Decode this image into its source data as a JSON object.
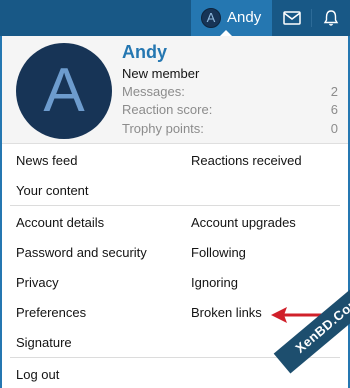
{
  "topbar": {
    "user_initial": "A",
    "user_name": "Andy",
    "icons": [
      "envelope-icon",
      "bell-icon"
    ]
  },
  "profile": {
    "avatar_initial": "A",
    "name": "Andy",
    "user_title": "New member",
    "stats": [
      {
        "label": "Messages:",
        "value": "2"
      },
      {
        "label": "Reaction score:",
        "value": "6"
      },
      {
        "label": "Trophy points:",
        "value": "0"
      }
    ]
  },
  "menu": {
    "news_feed": "News feed",
    "reactions_received": "Reactions received",
    "your_content": "Your content",
    "account_details": "Account details",
    "account_upgrades": "Account upgrades",
    "password_security": "Password and security",
    "following": "Following",
    "privacy": "Privacy",
    "ignoring": "Ignoring",
    "preferences": "Preferences",
    "broken_links": "Broken links",
    "signature": "Signature",
    "log_out": "Log out"
  },
  "annotation": {
    "icon": "red-arrow-icon",
    "color": "#d0202a"
  },
  "watermark": "XenBD.Com",
  "colors": {
    "brand_dark": "#185886",
    "brand": "#2577b1",
    "avatar_bg": "#173456"
  }
}
